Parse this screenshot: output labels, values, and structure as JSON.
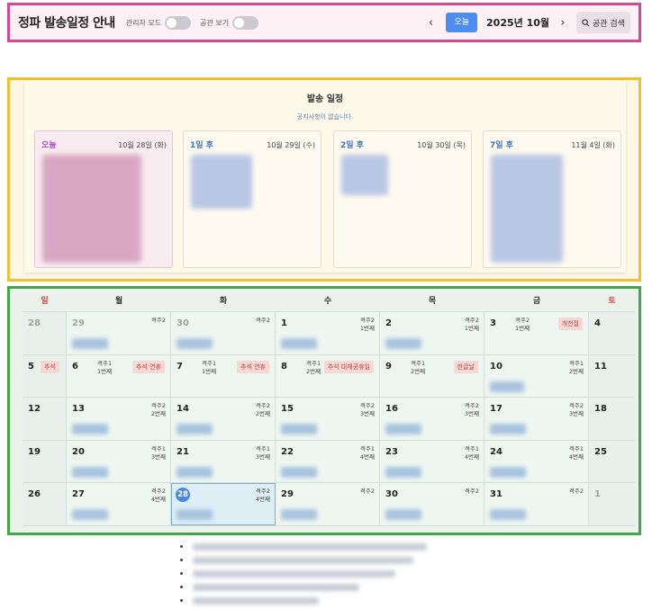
{
  "header": {
    "title": "정파 발송일정 안내",
    "admin_mode_label": "관리자 모드",
    "gongji_view_label": "공관 보기",
    "prev_icon": "‹",
    "next_icon": "›",
    "today_label": "오늘",
    "month_label": "2025년 10월",
    "search_label": "공관 검색"
  },
  "schedule": {
    "title": "발송 일정",
    "notice": "공지사항이 없습니다.",
    "cards": [
      {
        "rel": "오늘",
        "date": "10월 28일 (화)"
      },
      {
        "rel": "1일 후",
        "date": "10월 29일 (수)"
      },
      {
        "rel": "2일 후",
        "date": "10월 30일 (목)"
      },
      {
        "rel": "7일 후",
        "date": "11월 4일 (화)"
      }
    ]
  },
  "calendar": {
    "dow": [
      "일",
      "월",
      "화",
      "수",
      "목",
      "금",
      "토"
    ],
    "weeks": [
      [
        {
          "num": "28",
          "dim": true
        },
        {
          "num": "29",
          "dim": true,
          "info": [
            "격주2"
          ],
          "blur": true
        },
        {
          "num": "30",
          "dim": true,
          "info": [
            "격주2"
          ],
          "blur": true
        },
        {
          "num": "1",
          "info": [
            "격주2",
            "1번째"
          ],
          "blur": true
        },
        {
          "num": "2",
          "info": [
            "격주2",
            "1번째"
          ],
          "blur": true
        },
        {
          "num": "3",
          "info": [
            "격주2",
            "1번째"
          ],
          "holiday": "개천절"
        },
        {
          "num": "4"
        }
      ],
      [
        {
          "num": "5",
          "holiday": "추석"
        },
        {
          "num": "6",
          "info": [
            "격주1",
            "1번째"
          ],
          "holiday": "추석 연휴"
        },
        {
          "num": "7",
          "info": [
            "격주1",
            "1번째"
          ],
          "holiday": "추석 연휴"
        },
        {
          "num": "8",
          "info": [
            "격주1",
            "2번째"
          ],
          "holiday": "추석 대체공휴일"
        },
        {
          "num": "9",
          "info": [
            "격주1",
            "2번째"
          ],
          "holiday": "한글날"
        },
        {
          "num": "10",
          "info": [
            "격주1",
            "2번째"
          ],
          "blur": true
        },
        {
          "num": "11"
        }
      ],
      [
        {
          "num": "12"
        },
        {
          "num": "13",
          "info": [
            "격주2",
            "2번째"
          ],
          "blur": true
        },
        {
          "num": "14",
          "info": [
            "격주2",
            "2번째"
          ],
          "blur": true
        },
        {
          "num": "15",
          "info": [
            "격주2",
            "3번째"
          ],
          "blur": true
        },
        {
          "num": "16",
          "info": [
            "격주2",
            "3번째"
          ],
          "blur": true
        },
        {
          "num": "17",
          "info": [
            "격주2",
            "3번째"
          ],
          "blur": true
        },
        {
          "num": "18"
        }
      ],
      [
        {
          "num": "19"
        },
        {
          "num": "20",
          "info": [
            "격주1",
            "3번째"
          ],
          "blur": true
        },
        {
          "num": "21",
          "info": [
            "격주1",
            "3번째"
          ],
          "blur": true
        },
        {
          "num": "22",
          "info": [
            "격주1",
            "4번째"
          ],
          "blur": true
        },
        {
          "num": "23",
          "info": [
            "격주1",
            "4번째"
          ],
          "blur": true
        },
        {
          "num": "24",
          "info": [
            "격주1",
            "4번째"
          ],
          "blur": true
        },
        {
          "num": "25"
        }
      ],
      [
        {
          "num": "26"
        },
        {
          "num": "27",
          "info": [
            "격주2",
            "4번째"
          ],
          "blur": true
        },
        {
          "num": "28",
          "today": true,
          "info": [
            "격주2",
            "4번째"
          ],
          "blur": true
        },
        {
          "num": "29",
          "info": [
            "격주2"
          ],
          "blur": true
        },
        {
          "num": "30",
          "info": [
            "격주2"
          ],
          "blur": true
        },
        {
          "num": "31",
          "info": [
            "격주2"
          ],
          "blur": true
        },
        {
          "num": "1",
          "dim": true
        }
      ]
    ]
  },
  "colors": {
    "header_border": "#d44a92",
    "schedule_border": "#f0c030",
    "calendar_border": "#3fa946",
    "accent": "#4d8df0",
    "holiday": "#b8433b"
  }
}
